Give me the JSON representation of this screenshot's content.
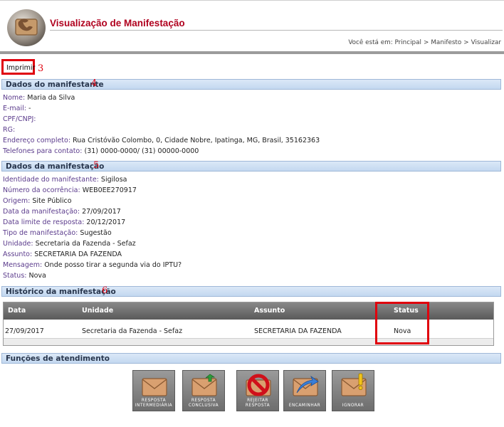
{
  "header": {
    "title": "Visualização de Manifestação",
    "breadcrumb": {
      "prefix": "Você está em:",
      "items": [
        "Principal",
        "Manifesto",
        "Visualizar"
      ],
      "separator": ">"
    }
  },
  "toolbar": {
    "print_label": "Imprimir"
  },
  "annotations": {
    "print": "3",
    "manifestant": "4",
    "manifestation": "5",
    "history": "6"
  },
  "manifestant": {
    "section_title": "Dados do manifestante",
    "fields": [
      {
        "label": "Nome:",
        "value": "Maria da Silva"
      },
      {
        "label": "E-mail:",
        "value": "-"
      },
      {
        "label": "CPF/CNPJ:",
        "value": ""
      },
      {
        "label": "RG:",
        "value": ""
      },
      {
        "label": "Endereço completo:",
        "value": "Rua Cristóvão Colombo, 0, Cidade Nobre, Ipatinga, MG, Brasil, 35162363"
      },
      {
        "label": "Telefones para contato:",
        "value": "(31) 0000-0000/ (31) 00000-0000"
      }
    ]
  },
  "manifestation": {
    "section_title": "Dados da manifestação",
    "fields": [
      {
        "label": "Identidade do manifestante:",
        "value": "Sigilosa"
      },
      {
        "label": "Número da ocorrência:",
        "value": "WEB0EE270917"
      },
      {
        "label": "Origem:",
        "value": "Site Público"
      },
      {
        "label": "Data da manifestação:",
        "value": "27/09/2017"
      },
      {
        "label": "Data limite de resposta:",
        "value": "20/12/2017"
      },
      {
        "label": "Tipo de manifestação:",
        "value": "Sugestão"
      },
      {
        "label": "Unidade:",
        "value": "Secretaria da Fazenda - Sefaz"
      },
      {
        "label": "Assunto:",
        "value": "SECRETARIA DA FAZENDA"
      },
      {
        "label": "Mensagem:",
        "value": "Onde posso tirar a segunda via do IPTU?"
      },
      {
        "label": "Status:",
        "value": "Nova"
      }
    ]
  },
  "history": {
    "section_title": "Histórico da manifestação",
    "columns": [
      "Data",
      "Unidade",
      "Assunto",
      "Status"
    ],
    "rows": [
      [
        "27/09/2017",
        "Secretaria da Fazenda - Sefaz",
        "SECRETARIA DA FAZENDA",
        "Nova"
      ]
    ]
  },
  "functions": {
    "section_title": "Funções de atendimento",
    "buttons": [
      {
        "line1": "RESPOSTA",
        "line2": "INTERMEDIÁRIA",
        "icon": "envelope-icon"
      },
      {
        "line1": "RESPOSTA",
        "line2": "CONCLUSIVA",
        "icon": "envelope-check-icon"
      },
      {
        "line1": "REJEITAR",
        "line2": "RESPOSTA",
        "icon": "envelope-reject-icon"
      },
      {
        "line1": "",
        "line2": "ENCAMINHAR",
        "icon": "envelope-forward-icon"
      },
      {
        "line1": "",
        "line2": "IGNORAR",
        "icon": "envelope-warning-icon"
      }
    ]
  },
  "colors": {
    "title": "#b0001e",
    "label": "#5b3b8c",
    "annotation": "#e0000d",
    "section_bar": "#c3d8f0"
  }
}
